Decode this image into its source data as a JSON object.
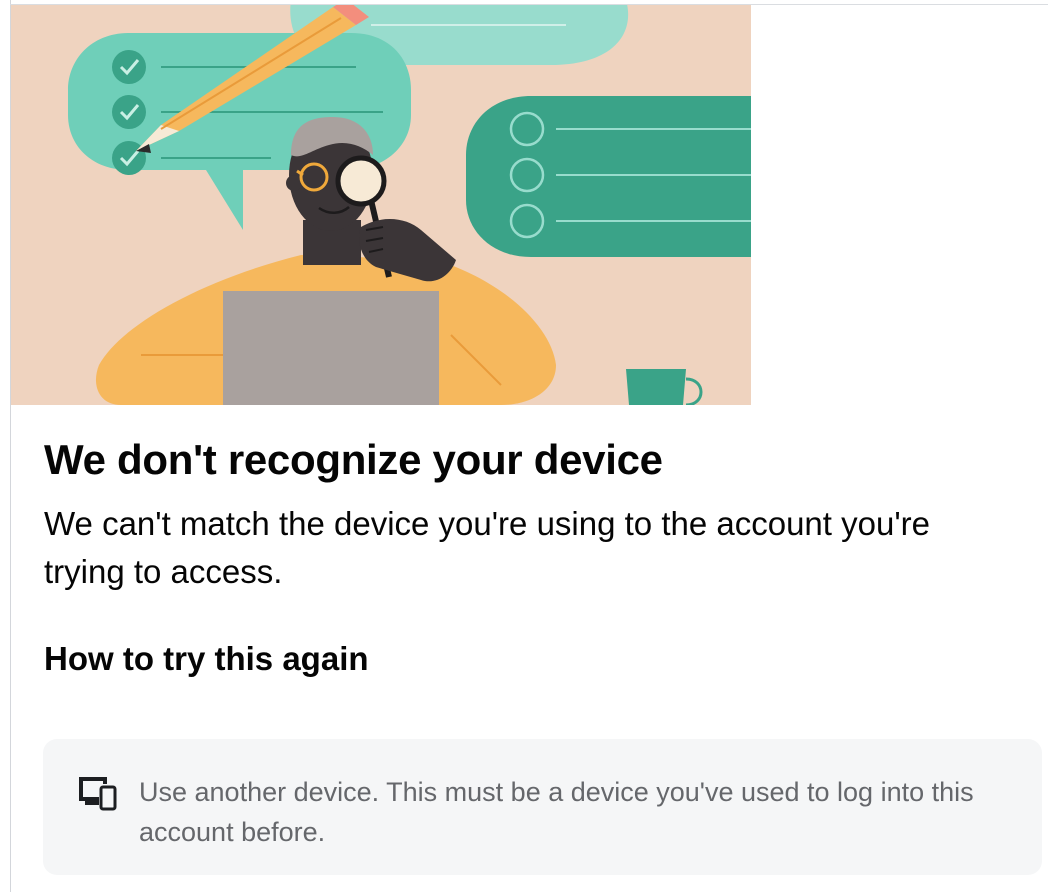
{
  "hero": {
    "illustration": "person-with-magnifying-glass-checklist-illustration",
    "colors": {
      "background": "#efd3bf",
      "bubble_light": "#6fcfb9",
      "bubble_pale": "#98dccd",
      "bubble_dark": "#3aa388",
      "pencil": "#f6b85d",
      "shirt": "#f6b85d",
      "laptop": "#a9a19e",
      "skin": "#3b3537"
    }
  },
  "content": {
    "title": "We don't recognize your device",
    "subtitle": "We can't match the device you're using to the account you're trying to access.",
    "section_heading": "How to try this again"
  },
  "options": [
    {
      "icon": "devices-icon",
      "text": "Use another device. This must be a device you've used to log into this account before."
    }
  ],
  "colors": {
    "text_primary": "#050505",
    "text_secondary": "#65676b",
    "card_background": "#f5f6f7"
  }
}
